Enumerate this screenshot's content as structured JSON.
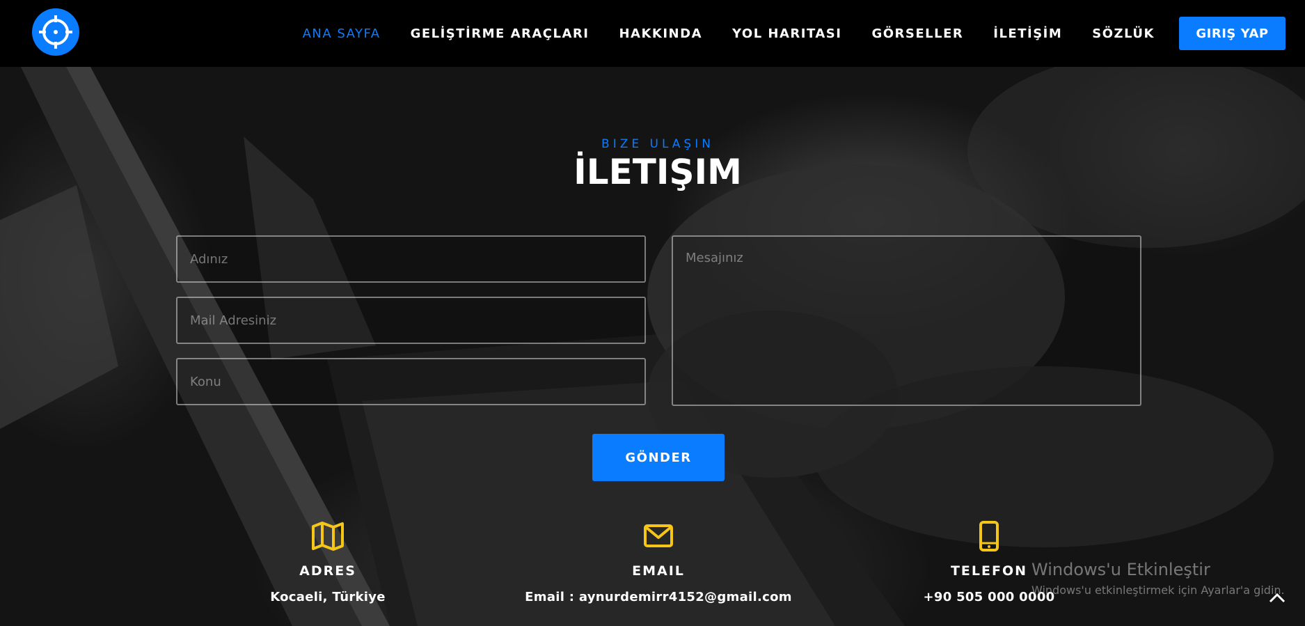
{
  "nav": {
    "logo_icon": "crosshair-logo-icon",
    "items": [
      {
        "label": "ANA SAYFA",
        "active": true
      },
      {
        "label": "GELİŞTİRME ARAÇLARI"
      },
      {
        "label": "HAKKINDA"
      },
      {
        "label": "YOL HARITASI"
      },
      {
        "label": "GÖRSELLER"
      },
      {
        "label": "İLETİŞİM"
      },
      {
        "label": "SÖZLÜK"
      }
    ],
    "login_label": "GIRIŞ YAP"
  },
  "section": {
    "subtitle": "BIZE ULAŞIN",
    "title": "İLETIŞIM"
  },
  "form": {
    "name_placeholder": "Adınız",
    "email_placeholder": "Mail Adresiniz",
    "subject_placeholder": "Konu",
    "message_placeholder": "Mesajınız",
    "submit_label": "GÖNDER"
  },
  "contact": {
    "address": {
      "icon": "map-icon",
      "label": "ADRES",
      "value": "Kocaeli, Türkiye"
    },
    "email": {
      "icon": "envelope-icon",
      "label": "EMAIL",
      "value": "Email : aynurdemirr4152@gmail.com"
    },
    "phone": {
      "icon": "mobile-phone-icon",
      "label": "TELEFON",
      "value": "+90 505 000 0000"
    }
  },
  "watermark": {
    "title": "Windows'u Etkinleştir",
    "subtitle": "Windows'u etkinleştirmek için Ayarlar'a gidin."
  },
  "colors": {
    "accent": "#0a7cff",
    "icon_yellow": "#f5c518",
    "nav_bg": "#000000"
  }
}
